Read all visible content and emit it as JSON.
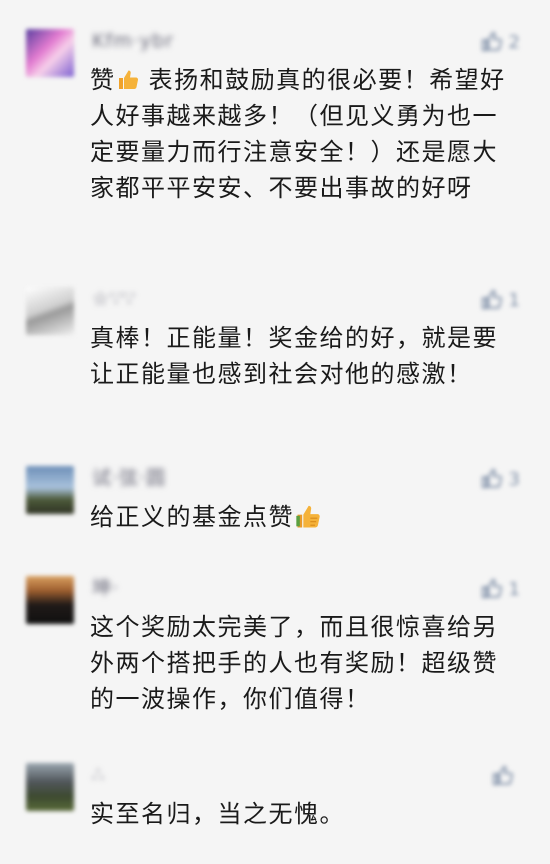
{
  "comments": [
    {
      "username": "Kfm·ybr",
      "likes": "2",
      "text_before": "赞",
      "text_after": " 表扬和鼓励真的很必要！希望好人好事越来越多！（但见义勇为也一定要量力而行注意安全！）还是愿大家都平平安安、不要出事故的好呀"
    },
    {
      "username": "☆∵∵",
      "likes": "1",
      "text": "真棒！正能量！奖金给的好，就是要让正能量也感到社会对他的感激！"
    },
    {
      "username": "试·弦·圆",
      "likes": "3",
      "text_before": "给正义的基金点赞"
    },
    {
      "username": "坤·",
      "likes": "1",
      "text": "这个奖励太完美了，而且很惊喜给另外两个搭把手的人也有奖励！超级赞的一波操作，你们值得！"
    },
    {
      "username": "∴",
      "likes": "",
      "text": "实至名归，当之无愧。"
    }
  ],
  "icons": {
    "like": "thumbs-up-icon",
    "emoji": "thumbs-up-emoji"
  },
  "colors": {
    "background": "#f5f5f5",
    "text": "#1a1a1a",
    "meta": "#8090a8",
    "emoji": "#f5b23a"
  }
}
